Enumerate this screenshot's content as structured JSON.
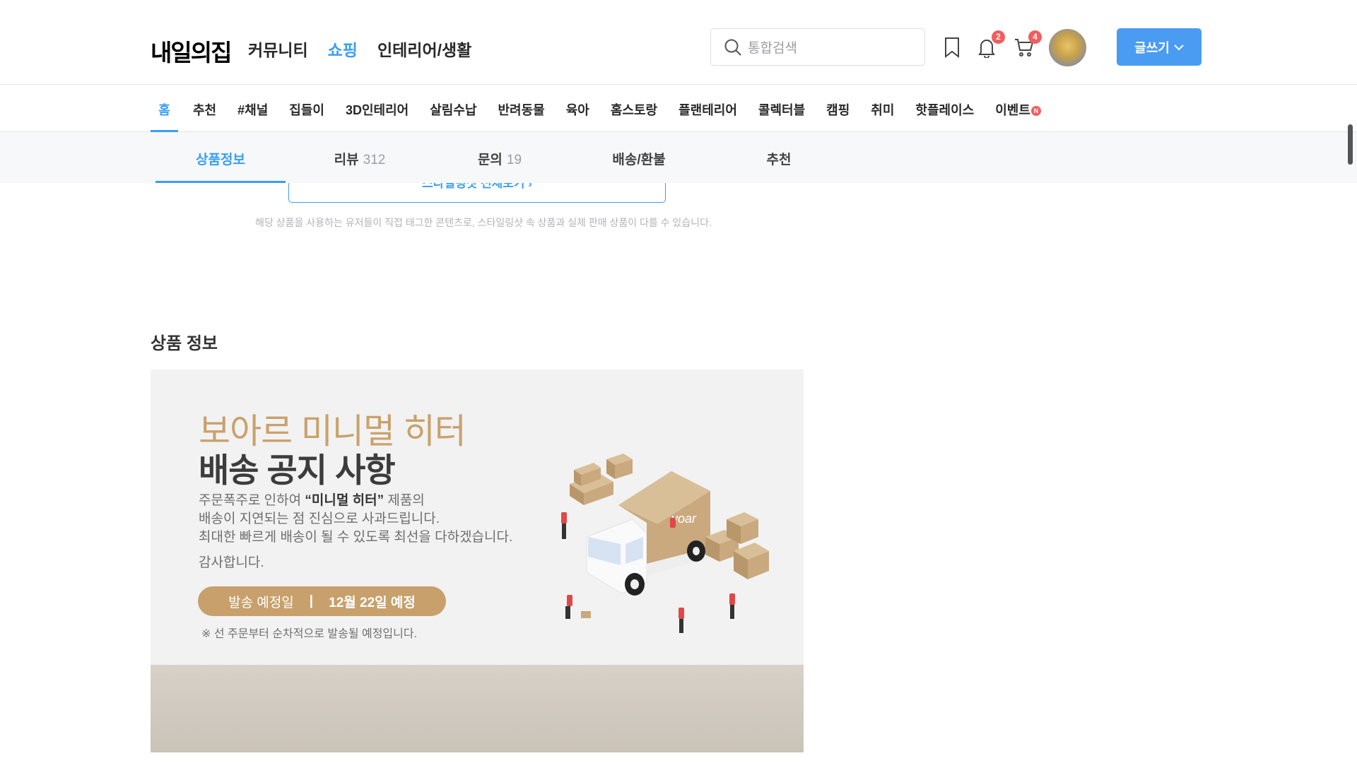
{
  "header": {
    "logo": "내일의집",
    "nav": [
      {
        "label": "커뮤니티"
      },
      {
        "label": "쇼핑",
        "active": true
      },
      {
        "label": "인테리어/생활"
      }
    ],
    "search_placeholder": "통합검색",
    "notification_count": "2",
    "cart_count": "4",
    "write_label": "글쓰기"
  },
  "subnav": {
    "items": [
      "홈",
      "추천",
      "#채널",
      "집들이",
      "3D인테리어",
      "살림수납",
      "반려동물",
      "육아",
      "홈스토랑",
      "플랜테리어",
      "콜렉터블",
      "캠핑",
      "취미",
      "핫플레이스",
      "이벤트"
    ],
    "event_badge": "N"
  },
  "tabs": [
    {
      "label": "상품정보",
      "count": ""
    },
    {
      "label": "리뷰",
      "count": "312"
    },
    {
      "label": "문의",
      "count": "19"
    },
    {
      "label": "배송/환불",
      "count": ""
    },
    {
      "label": "추천",
      "count": ""
    }
  ],
  "styling": {
    "button_label": "스타일링샷 전체보기 ›",
    "disclaimer": "해당 상품을 사용하는 유저들이 직접 태그한 콘텐츠로, 스타일링샷 속 상품과 실제 판매 상품이 다를 수 있습니다."
  },
  "product_info": {
    "title": "상품 정보",
    "banner": {
      "title1": "보아르 미니멀 히터",
      "title2": "배송 공지 사항",
      "line1_pre": "주문폭주로 인하여 ",
      "line1_bold": "“미니멀 히터”",
      "line1_post": " 제품의",
      "line2": "배송이 지연되는 점 진심으로 사과드립니다.",
      "line3": "최대한 빠르게 배송이 될 수 있도록 최선을 다하겠습니다.",
      "thanks": "감사합니다.",
      "pill_label": "발송 예정일",
      "pill_sep": "|",
      "pill_date": "12월 22일 예정",
      "note": "※ 선 주문부터 순차적으로 발송될 예정입니다.",
      "box_brand": "voar"
    }
  },
  "colors": {
    "accent": "#3a9ef5",
    "gold": "#c7a06b",
    "badge": "#f25d5d"
  }
}
